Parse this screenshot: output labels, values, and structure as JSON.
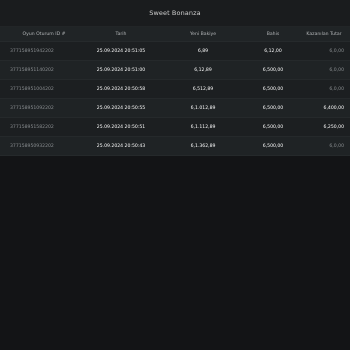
{
  "header": {
    "title": "Sweet Bonanza"
  },
  "table": {
    "columns": [
      "Oyun Oturum ID #",
      "Tarih",
      "Yeni Bakiye",
      "Bahis",
      "Kazanılan Tutar"
    ],
    "rows": [
      {
        "id": "377158951942202",
        "date": "25.09.2024 20:51:05",
        "balance": "6,89",
        "bet": "6,12,00",
        "win": "6,0,00"
      },
      {
        "id": "377158951140202",
        "date": "25.09.2024 20:51:00",
        "balance": "6,12,89",
        "bet": "6,500,00",
        "win": "6,0,00"
      },
      {
        "id": "377158951004202",
        "date": "25.09.2024 20:50:58",
        "balance": "6,512,89",
        "bet": "6,500,00",
        "win": "6,0,00"
      },
      {
        "id": "377158951092202",
        "date": "25.09.2024 20:50:55",
        "balance": "6,1.012,89",
        "bet": "6,500,00",
        "win": "6,400,00"
      },
      {
        "id": "377158951582202",
        "date": "25.09.2024 20:50:51",
        "balance": "6,1.112,89",
        "bet": "6,500,00",
        "win": "6,250,00"
      },
      {
        "id": "377158950932202",
        "date": "25.09.2024 20:50:43",
        "balance": "6,1.362,89",
        "bet": "6,500,00",
        "win": "6,0,00"
      }
    ]
  }
}
